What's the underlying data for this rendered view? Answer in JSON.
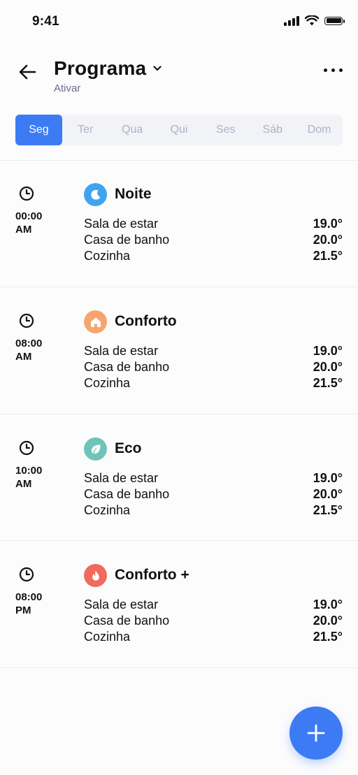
{
  "status_bar": {
    "time": "9:41"
  },
  "header": {
    "title": "Programa",
    "subtitle": "Ativar"
  },
  "days": [
    "Seg",
    "Ter",
    "Qua",
    "Qui",
    "Ses",
    "Sáb",
    "Dom"
  ],
  "active_day": "Seg",
  "entries": [
    {
      "time_line1": "00:00",
      "time_line2": "AM",
      "mode": "Noite",
      "icon": "moon-icon",
      "icon_color": "#3fa4f0",
      "rooms": [
        {
          "name": "Sala de estar",
          "temp": "19.0°"
        },
        {
          "name": "Casa de banho",
          "temp": "20.0°"
        },
        {
          "name": "Cozinha",
          "temp": "21.5°"
        }
      ]
    },
    {
      "time_line1": "08:00",
      "time_line2": "AM",
      "mode": "Conforto",
      "icon": "home-icon",
      "icon_color": "#f5a66e",
      "rooms": [
        {
          "name": "Sala de estar",
          "temp": "19.0°"
        },
        {
          "name": "Casa de banho",
          "temp": "20.0°"
        },
        {
          "name": "Cozinha",
          "temp": "21.5°"
        }
      ]
    },
    {
      "time_line1": "10:00",
      "time_line2": "AM",
      "mode": "Eco",
      "icon": "leaf-icon",
      "icon_color": "#6fc4b8",
      "rooms": [
        {
          "name": "Sala de estar",
          "temp": "19.0°"
        },
        {
          "name": "Casa de banho",
          "temp": "20.0°"
        },
        {
          "name": "Cozinha",
          "temp": "21.5°"
        }
      ]
    },
    {
      "time_line1": "08:00",
      "time_line2": "PM",
      "mode": "Conforto +",
      "icon": "flame-icon",
      "icon_color": "#f06b5d",
      "rooms": [
        {
          "name": "Sala de estar",
          "temp": "19.0°"
        },
        {
          "name": "Casa de banho",
          "temp": "20.0°"
        },
        {
          "name": "Cozinha",
          "temp": "21.5°"
        }
      ]
    }
  ],
  "colors": {
    "accent": "#3d7bf5",
    "inactive_day": "#b0b0c4",
    "subtitle": "#6c6c8a"
  },
  "fab": {
    "icon": "plus-icon"
  }
}
